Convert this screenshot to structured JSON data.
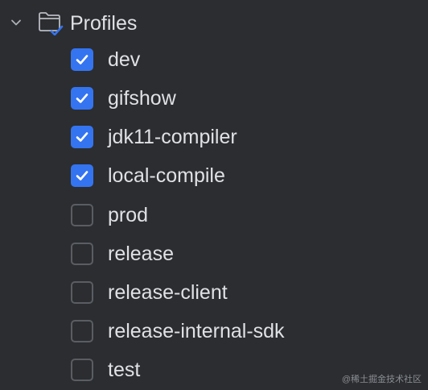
{
  "profiles": {
    "group_label": "Profiles",
    "expanded": true,
    "items": [
      {
        "label": "dev",
        "checked": true
      },
      {
        "label": "gifshow",
        "checked": true
      },
      {
        "label": "jdk11-compiler",
        "checked": true
      },
      {
        "label": "local-compile",
        "checked": true
      },
      {
        "label": "prod",
        "checked": false
      },
      {
        "label": "release",
        "checked": false
      },
      {
        "label": "release-client",
        "checked": false
      },
      {
        "label": "release-internal-sdk",
        "checked": false
      },
      {
        "label": "test",
        "checked": false
      }
    ]
  },
  "icons": {
    "expand": "chevron-down-icon",
    "group": "folder-check-icon",
    "checkmark": "checkmark-icon"
  },
  "colors": {
    "background": "#2b2d30",
    "text": "#dfe1e5",
    "checkbox_checked": "#3574f0",
    "checkbox_border": "#5a5d63"
  },
  "watermark": "@稀土掘金技术社区"
}
